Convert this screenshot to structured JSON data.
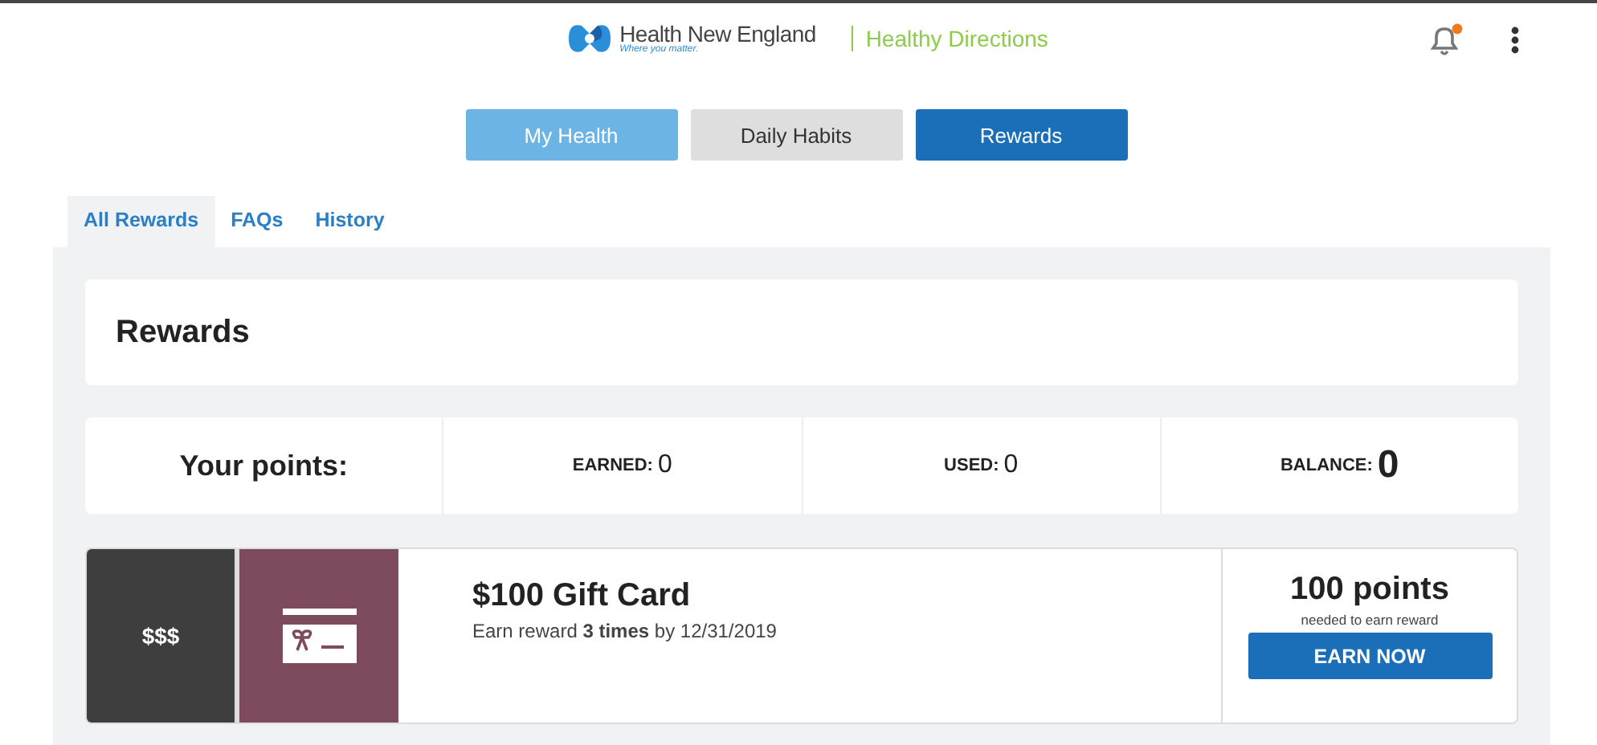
{
  "header": {
    "brand": "Health New England",
    "tagline": "Where you matter.",
    "program": "Healthy Directions",
    "notification_unread": true
  },
  "main_tabs": [
    {
      "label": "My Health",
      "color": "#6cb4e4"
    },
    {
      "label": "Daily Habits",
      "color": "#dedede"
    },
    {
      "label": "Rewards",
      "color": "#1a6fb8"
    }
  ],
  "sub_tabs": [
    {
      "label": "All Rewards",
      "selected": true
    },
    {
      "label": "FAQs",
      "selected": false
    },
    {
      "label": "History",
      "selected": false
    }
  ],
  "page_title": "Rewards",
  "points": {
    "label": "Your points:",
    "stats": [
      {
        "label": "EARNED:",
        "value": "0"
      },
      {
        "label": "USED:",
        "value": "0"
      },
      {
        "label": "BALANCE:",
        "value": "0"
      }
    ]
  },
  "rewards": [
    {
      "tag": "$$$",
      "title": "$100 Gift Card",
      "subtitle": "Earn reward **3 times** by 12/31/2019",
      "cost": "100 points",
      "cost_note": "needed to earn reward",
      "button": "EARN NOW"
    }
  ]
}
